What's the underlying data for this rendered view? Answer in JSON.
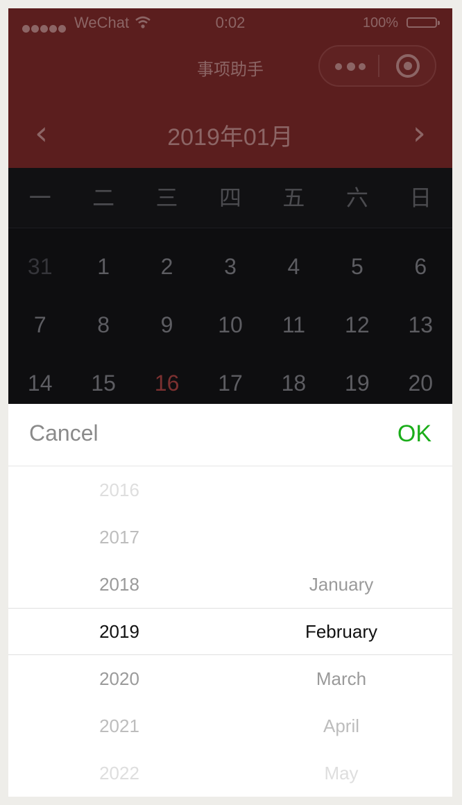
{
  "status_bar": {
    "carrier": "WeChat",
    "time": "0:02",
    "battery_percent": "100%"
  },
  "nav": {
    "title": "事项助手",
    "more_icon": "more-dots-icon",
    "close_icon": "target-icon"
  },
  "calendar": {
    "month_label": "2019年01月",
    "prev_icon": "chevron-left-icon",
    "next_icon": "chevron-right-icon",
    "weekdays": [
      "一",
      "二",
      "三",
      "四",
      "五",
      "六",
      "日"
    ],
    "days": [
      "31",
      "1",
      "2",
      "3",
      "4",
      "5",
      "6",
      "7",
      "8",
      "9",
      "10",
      "11",
      "12",
      "13",
      "14",
      "15",
      "16",
      "17",
      "18",
      "19",
      "20"
    ],
    "selected_day": "16",
    "accent_color": "#5b1e1e"
  },
  "picker": {
    "cancel_label": "Cancel",
    "ok_label": "OK",
    "ok_color": "#1aad19",
    "years": [
      "2016",
      "2017",
      "2018",
      "2019",
      "2020",
      "2021",
      "2022"
    ],
    "selected_year": "2019",
    "months": [
      "January",
      "February",
      "March",
      "April",
      "May"
    ],
    "selected_month": "February"
  }
}
